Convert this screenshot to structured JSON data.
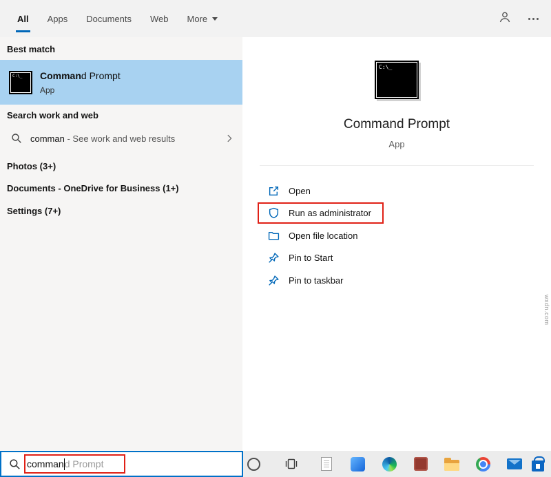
{
  "topbar": {
    "tabs": [
      {
        "label": "All",
        "active": true
      },
      {
        "label": "Apps",
        "active": false
      },
      {
        "label": "Documents",
        "active": false
      },
      {
        "label": "Web",
        "active": false
      },
      {
        "label": "More",
        "active": false
      }
    ]
  },
  "left_panel": {
    "best_match_header": "Best match",
    "best_match": {
      "title_bold": "Comman",
      "title_rest": "d Prompt",
      "subtitle": "App"
    },
    "search_web_header": "Search work and web",
    "suggestion": {
      "query": "comman",
      "rest": " - See work and web results"
    },
    "categories": [
      {
        "label": "Photos (3+)"
      },
      {
        "label": "Documents - OneDrive for Business (1+)"
      },
      {
        "label": "Settings (7+)"
      }
    ]
  },
  "right_panel": {
    "app_name": "Command Prompt",
    "app_type": "App",
    "actions": [
      {
        "label": "Open"
      },
      {
        "label": "Run as administrator"
      },
      {
        "label": "Open file location"
      },
      {
        "label": "Pin to Start"
      },
      {
        "label": "Pin to taskbar"
      }
    ]
  },
  "icons": {
    "cmd_prompt_text": "C:\\_"
  },
  "taskbar": {
    "search_typed": "comman",
    "search_ghost": "d Prompt"
  },
  "colors": {
    "accent_blue": "#0067b8",
    "highlight_blue": "#a8d2f1",
    "annotation_red": "#e02016"
  },
  "watermark": "wxdn.com"
}
